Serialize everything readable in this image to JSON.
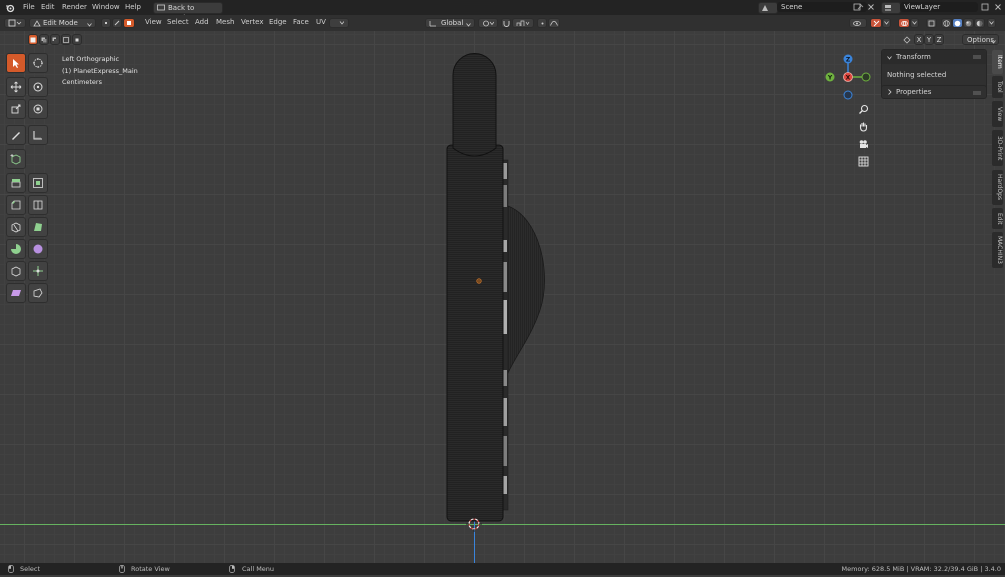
{
  "topbar": {
    "menus": [
      "File",
      "Edit",
      "Render",
      "Window",
      "Help"
    ],
    "back_button": "Back to Previous",
    "scene": "Scene",
    "view_layer": "ViewLayer"
  },
  "header": {
    "mode": "Edit Mode",
    "menus": [
      "View",
      "Select",
      "Add",
      "Mesh",
      "Vertex",
      "Edge",
      "Face",
      "UV"
    ],
    "orientation": "Global",
    "axes": [
      "X",
      "Y",
      "Z"
    ],
    "options": "Options"
  },
  "viewport": {
    "view_name": "Left Orthographic",
    "object_name": "(1) PlanetExpress_Main",
    "units": "Centimeters"
  },
  "gizmo": {
    "x": "X",
    "y": "Y",
    "z": "Z"
  },
  "npanel": {
    "transform_title": "Transform",
    "transform_body": "Nothing selected",
    "properties_title": "Properties",
    "tabs": [
      "Item",
      "Tool",
      "View",
      "3D-Print",
      "HardOps",
      "Edit",
      "MACHIN3"
    ]
  },
  "status": {
    "select": "Select",
    "rotate": "Rotate View",
    "call_menu": "Call Menu",
    "stats": "Memory: 628.5 MiB | VRAM: 32.2/39.4 GiB | 3.4.0"
  },
  "colors": {
    "accent": "#d45a2a",
    "selected": "#5680c2",
    "axis_x": "#e0473f",
    "axis_y": "#6fb23f",
    "axis_z": "#3a84db",
    "y_axis_line": "#65b25f"
  }
}
